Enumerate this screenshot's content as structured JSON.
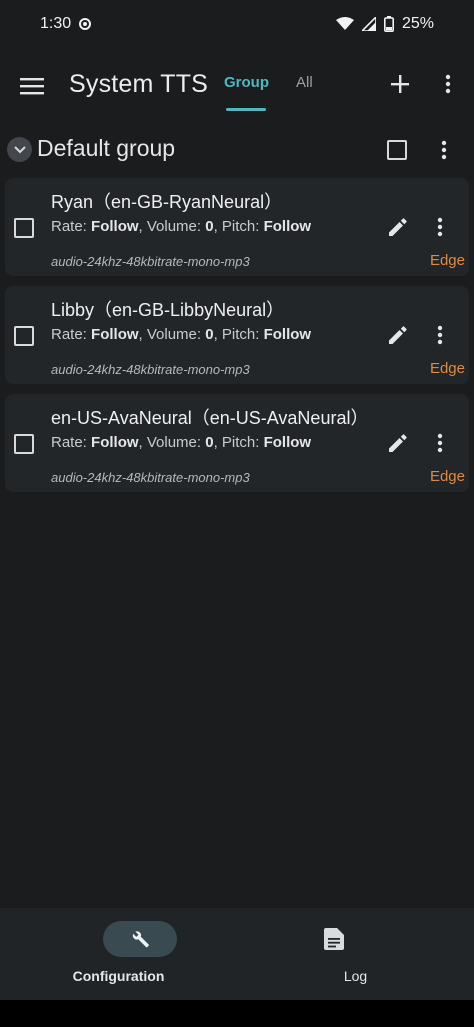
{
  "status_bar": {
    "time": "1:30",
    "battery": "25%"
  },
  "app_bar": {
    "title": "System TTS",
    "tabs": [
      {
        "label": "Group",
        "selected": true
      },
      {
        "label": "All",
        "selected": false
      }
    ],
    "icons": [
      "menu-icon",
      "add-icon",
      "more-vert-icon"
    ]
  },
  "group": {
    "name": "Default group",
    "expanded": true,
    "checked": false
  },
  "voices": [
    {
      "title": "Ryan（en-GB-RyanNeural）",
      "rate_label": "Rate: ",
      "rate": "Follow",
      "volume_label": ", Volume: ",
      "volume": "0",
      "pitch_label": ", Pitch: ",
      "pitch": "Follow",
      "format": "audio-24khz-48kbitrate-mono-mp3",
      "engine": "Edge",
      "checked": false
    },
    {
      "title": "Libby（en-GB-LibbyNeural）",
      "rate_label": "Rate: ",
      "rate": "Follow",
      "volume_label": ", Volume: ",
      "volume": "0",
      "pitch_label": ", Pitch: ",
      "pitch": "Follow",
      "format": "audio-24khz-48kbitrate-mono-mp3",
      "engine": "Edge",
      "checked": false
    },
    {
      "title": "en-US-AvaNeural（en-US-AvaNeural）",
      "rate_label": "Rate: ",
      "rate": "Follow",
      "volume_label": ", Volume: ",
      "volume": "0",
      "pitch_label": ", Pitch: ",
      "pitch": "Follow",
      "format": "audio-24khz-48kbitrate-mono-mp3",
      "engine": "Edge",
      "checked": false
    }
  ],
  "bottom_nav": [
    {
      "label": "Configuration",
      "icon": "wrench-icon",
      "selected": true
    },
    {
      "label": "Log",
      "icon": "document-icon",
      "selected": false
    }
  ],
  "colors": {
    "background": "#1a1c1e",
    "card": "#222629",
    "accent": "#4fb7c0",
    "engine": "#e08a3c",
    "nav_pill": "#394a50"
  }
}
